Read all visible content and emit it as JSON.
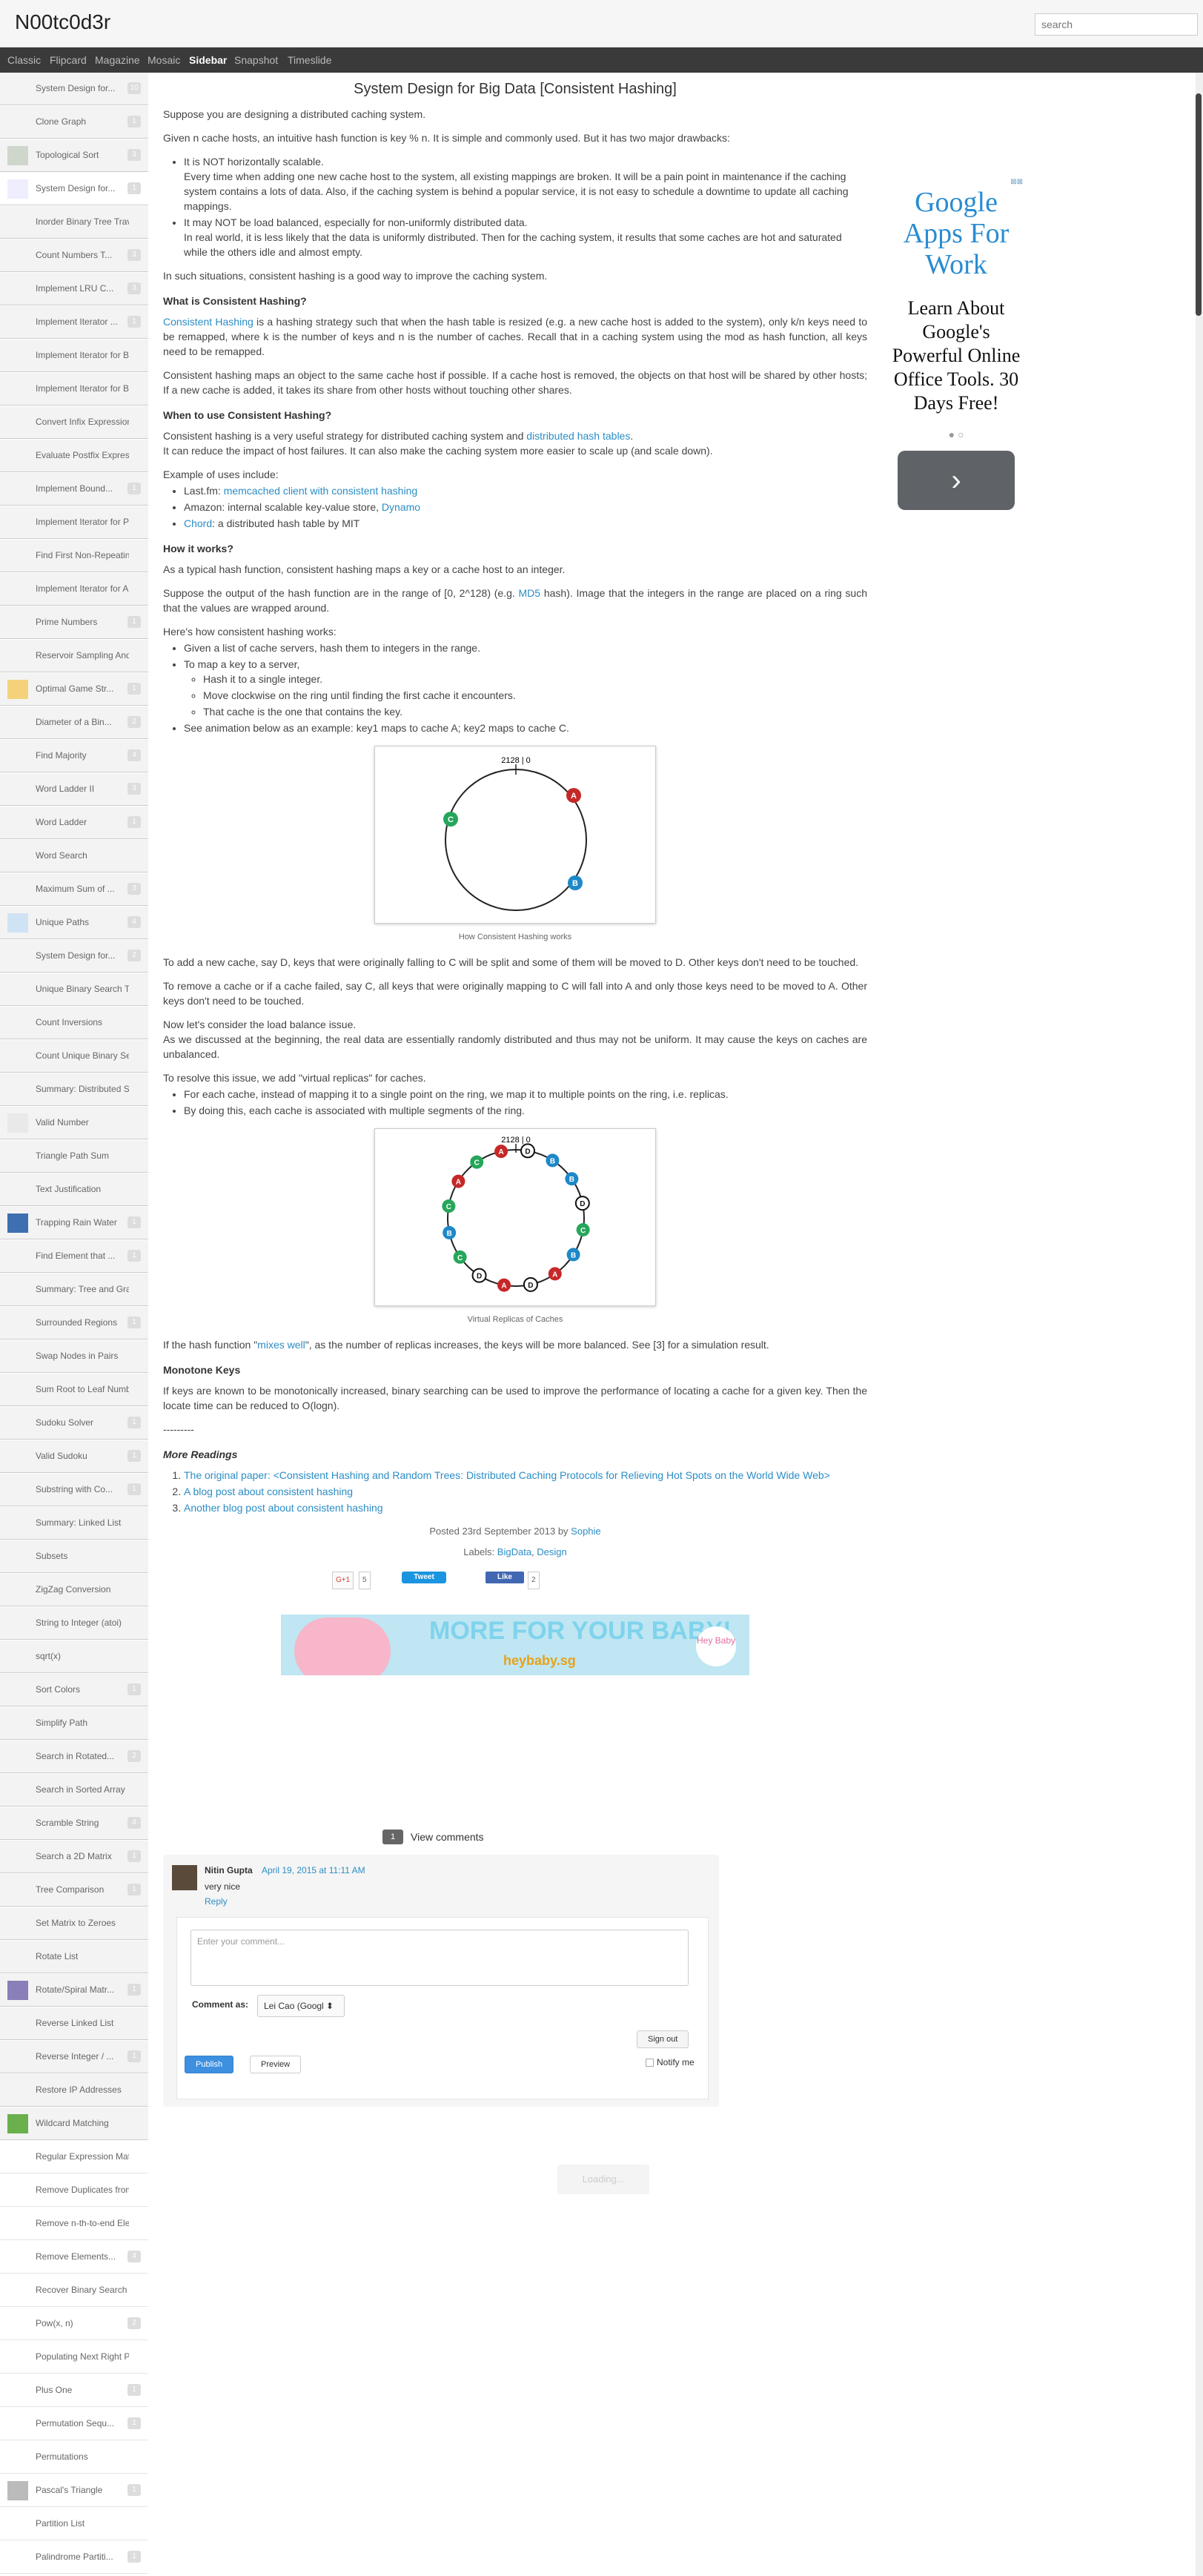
{
  "header": {
    "title": "N00tc0d3r",
    "search_placeholder": "search"
  },
  "nav": {
    "items": [
      "Classic",
      "Flipcard",
      "Magazine",
      "Mosaic",
      "Sidebar",
      "Snapshot",
      "Timeslide"
    ],
    "active": "Sidebar"
  },
  "sidebar": {
    "items": [
      {
        "label": "System Design for...",
        "count": "10"
      },
      {
        "label": "Clone Graph",
        "count": "1"
      },
      {
        "label": "Topological Sort",
        "count": "3"
      },
      {
        "label": "System Design for...",
        "count": "1"
      },
      {
        "label": "Inorder Binary Tree Trave...",
        "count": ""
      },
      {
        "label": "Count Numbers T...",
        "count": "3"
      },
      {
        "label": "Implement LRU C...",
        "count": "3"
      },
      {
        "label": "Implement Iterator ...",
        "count": "1"
      },
      {
        "label": "Implement Iterator for Bin...",
        "count": ""
      },
      {
        "label": "Implement Iterator for Bin...",
        "count": ""
      },
      {
        "label": "Convert Infix Expression ...",
        "count": ""
      },
      {
        "label": "Evaluate Postfix Expression",
        "count": ""
      },
      {
        "label": "Implement Bound...",
        "count": "1"
      },
      {
        "label": "Implement Iterator for Pe...",
        "count": ""
      },
      {
        "label": "Find First Non-Repeating...",
        "count": ""
      },
      {
        "label": "Implement Iterator for Array",
        "count": ""
      },
      {
        "label": "Prime Numbers",
        "count": "1"
      },
      {
        "label": "Reservoir Sampling And ...",
        "count": ""
      },
      {
        "label": "Optimal Game Str...",
        "count": "1"
      },
      {
        "label": "Diameter of a Bin...",
        "count": "2"
      },
      {
        "label": "Find Majority",
        "count": "4"
      },
      {
        "label": "Word Ladder II",
        "count": "3"
      },
      {
        "label": "Word Ladder",
        "count": "1"
      },
      {
        "label": "Word Search",
        "count": ""
      },
      {
        "label": "Maximum Sum of ...",
        "count": "3"
      },
      {
        "label": "Unique Paths",
        "count": "4"
      },
      {
        "label": "System Design for...",
        "count": "2"
      },
      {
        "label": "Unique Binary Search Tr...",
        "count": ""
      },
      {
        "label": "Count Inversions",
        "count": ""
      },
      {
        "label": "Count Unique Binary Sea...",
        "count": ""
      },
      {
        "label": "Summary: Distributed Sy...",
        "count": ""
      },
      {
        "label": "Valid Number",
        "count": ""
      },
      {
        "label": "Triangle Path Sum",
        "count": ""
      },
      {
        "label": "Text Justification",
        "count": ""
      },
      {
        "label": "Trapping Rain Water",
        "count": "1"
      },
      {
        "label": "Find Element that ...",
        "count": "1"
      },
      {
        "label": "Summary: Tree and Graph",
        "count": ""
      },
      {
        "label": "Surrounded Regions",
        "count": "1"
      },
      {
        "label": "Swap Nodes in Pairs",
        "count": ""
      },
      {
        "label": "Sum Root to Leaf Numbers",
        "count": ""
      },
      {
        "label": "Sudoku Solver",
        "count": "1"
      },
      {
        "label": "Valid Sudoku",
        "count": "1"
      },
      {
        "label": "Substring with Co...",
        "count": "1"
      },
      {
        "label": "Summary: Linked List",
        "count": ""
      },
      {
        "label": "Subsets",
        "count": ""
      },
      {
        "label": "ZigZag Conversion",
        "count": ""
      },
      {
        "label": "String to Integer (atoi)",
        "count": ""
      },
      {
        "label": "sqrt(x)",
        "count": ""
      },
      {
        "label": "Sort Colors",
        "count": "1"
      },
      {
        "label": "Simplify Path",
        "count": ""
      },
      {
        "label": "Search in Rotated...",
        "count": "2"
      },
      {
        "label": "Search in Sorted Array",
        "count": ""
      },
      {
        "label": "Scramble String",
        "count": "4"
      },
      {
        "label": "Search a 2D Matrix",
        "count": "1"
      },
      {
        "label": "Tree Comparison",
        "count": "1"
      },
      {
        "label": "Set Matrix to Zeroes",
        "count": ""
      },
      {
        "label": "Rotate List",
        "count": ""
      },
      {
        "label": "Rotate/Spiral Matr...",
        "count": "1"
      },
      {
        "label": "Reverse Linked List",
        "count": ""
      },
      {
        "label": "Reverse Integer / ...",
        "count": "1"
      },
      {
        "label": "Restore IP Addresses",
        "count": ""
      },
      {
        "label": "Wildcard Matching",
        "count": ""
      },
      {
        "label": "Regular Expression Matc...",
        "count": ""
      },
      {
        "label": "Remove Duplicates from ...",
        "count": ""
      },
      {
        "label": "Remove n-th-to-end Ele...",
        "count": ""
      },
      {
        "label": "Remove Elements...",
        "count": "4"
      },
      {
        "label": "Recover Binary Search T...",
        "count": ""
      },
      {
        "label": "Pow(x, n)",
        "count": "2"
      },
      {
        "label": "Populating Next Right Po...",
        "count": ""
      },
      {
        "label": "Plus One",
        "count": "1"
      },
      {
        "label": "Permutation Sequ...",
        "count": "1"
      },
      {
        "label": "Permutations",
        "count": ""
      },
      {
        "label": "Pascal's Triangle",
        "count": "1"
      },
      {
        "label": "Partition List",
        "count": ""
      },
      {
        "label": "Palindrome Partiti...",
        "count": "1"
      }
    ]
  },
  "post": {
    "title": "System Design for Big Data [Consistent Hashing]",
    "intro": "Suppose you are designing a distributed caching system.",
    "p1": "Given n cache hosts, an intuitive hash function is key % n. It is simple and commonly used. But it has two major drawbacks:",
    "d1_title": "It is NOT horizontally scalable.",
    "d1_text": "Every time when adding one new cache host to the system, all existing mappings are broken. It will be a pain point in maintenance if the caching system contains a lots of data. Also, if the caching system is behind a popular service, it is not easy to schedule a downtime to update all caching mappings.",
    "d2_title": "It may NOT be load balanced, especially for non-uniformly distributed data.",
    "d2_text": "In real world, it is less likely that the data is uniformly distributed. Then for the caching system, it results that some caches are hot and saturated while the others idle and almost empty.",
    "p2": "In such situations, consistent hashing is a good way to improve the caching system.",
    "h_what": "What is Consistent Hashing?",
    "what_link": "Consistent Hashing",
    "what_text": " is a hashing strategy such that when the hash table is resized (e.g. a new cache host is added to the system), only k/n keys need to be remapped, where k is the number of keys and n is the number of caches. Recall that in a caching system using the mod as hash function, all keys need to be remapped.",
    "what_p2": "Consistent hashing maps an object to the same cache host if possible. If a cache host is removed, the objects on that host will be shared by other hosts; If a new cache is added, it takes its share from other hosts without touching other shares.",
    "h_when": "When to use Consistent Hashing?",
    "when_text1": "Consistent hashing is a very useful strategy for distributed caching system and ",
    "when_link": "distributed hash tables",
    "when_text2": "It can reduce the impact of host failures. It can also make the caching system more easier to scale up (and scale down).",
    "uses_title": "Example of uses include:",
    "use1_a": "Last.fm: ",
    "use1_link": "memcached client with consistent hashing",
    "use2_a": "Amazon: internal scalable key-value store, ",
    "use2_link": "Dynamo",
    "use3_link": "Chord",
    "use3_b": ": a distributed hash table by MIT",
    "h_how": "How it works?",
    "how_p1": "As a typical hash function, consistent hashing maps a key or a cache host to an integer.",
    "how_p2a": "Suppose the output of the hash function are in the range of [0, 2^128) (e.g. ",
    "how_p2_link": "MD5",
    "how_p2b": " hash). Image that the integers in the range are placed on a ring such that the values are wrapped around.",
    "how_p3": "Here's how consistent hashing works:",
    "step1": "Given a list of cache servers, hash them to integers in the range.",
    "step2": "To map a key to a server,",
    "sub1": "Hash it to a single integer.",
    "sub2": "Move clockwise on the ring until finding the first cache it encounters.",
    "sub3": "That cache is the one that contains the key.",
    "step3": "See animation below as an example: key1 maps to cache A; key2 maps to cache C.",
    "fig1_caption": "How Consistent Hashing works",
    "fig_top_label": "2128 | 0",
    "add_p": "To add a new cache, say D, keys that were originally falling to C will be split and some of them will be moved to D. Other keys don't need to be touched.",
    "remove_p": "To remove a cache or if a cache failed, say C, all keys that were originally mapping to C will fall into A and only those keys need to be moved to A. Other keys don't need to be touched.",
    "load_p1": "Now let's consider the load balance issue.",
    "load_p2": "As we discussed at the beginning, the real data are essentially randomly distributed and thus may not be uniform. It may cause the keys on caches are unbalanced.",
    "resolve_p": "To resolve this issue, we add \"virtual replicas\" for caches.",
    "r1": "For each cache, instead of mapping it to a single point on the ring, we map it to multiple points on the ring, i.e. replicas.",
    "r2": "By doing this, each cache is associated with multiple segments of the ring.",
    "fig2_caption": "Virtual Replicas of Caches",
    "mix_a": "If the hash function \"",
    "mix_link": "mixes well",
    "mix_b": "\", as the number of replicas increases, the keys will be more balanced. See [3] for a simulation result.",
    "h_mono": "Monotone Keys",
    "mono_p": "If keys are known to be monotonically increased, binary searching can be used to improve the performance of locating a cache for a given key. Then the locate time can be reduced to O(logn).",
    "sep": "---------",
    "h_more": "More Readings",
    "read1": "The original paper: <Consistent Hashing and Random Trees: Distributed Caching Protocols for Relieving Hot Spots on the World Wide Web>",
    "read2": "A blog post about consistent hashing",
    "read3": "Another blog post about consistent hashing",
    "posted_a": "Posted ",
    "posted_date": "23rd September 2013",
    "posted_b": " by ",
    "posted_author": "Sophie",
    "labels_a": "Labels: ",
    "label1": "BigData",
    "label2": "Design",
    "gplus": "G+1",
    "gplus_count": "5",
    "tweet": "Tweet",
    "like": "Like",
    "like_count": "2"
  },
  "banner": {
    "text1": "MORE FOR YOUR BABY!",
    "text2": "heybaby.sg",
    "logo": "Hey Baby"
  },
  "ad": {
    "title": "Google Apps For Work",
    "body": "Learn About Google's Powerful Online Office Tools. 30 Days Free!",
    "dots": "● ○",
    "arrow": "›",
    "close": "⊠⊠"
  },
  "comments": {
    "count": "1",
    "view_label": "View comments",
    "author": "Nitin Gupta",
    "date": "April 19, 2015 at 11:11 AM",
    "text": "very nice",
    "reply": "Reply",
    "placeholder": "Enter your comment...",
    "comment_as": "Comment as:",
    "identity": "Lei Cao (Googl",
    "sign_out": "Sign out",
    "publish": "Publish",
    "preview": "Preview",
    "notify": "Notify me",
    "loading": "Loading..."
  },
  "colors": {
    "cache_a": "#c62828",
    "cache_b": "#1e88c8",
    "cache_c": "#26a65b",
    "cache_d": "#111111",
    "link": "#2b8dc6",
    "nav_bg": "#3a3a3a"
  }
}
